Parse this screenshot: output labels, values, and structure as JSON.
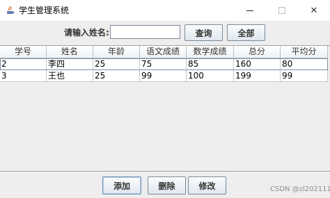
{
  "window": {
    "title": "学生管理系统",
    "minimize_glyph": "",
    "close_glyph": "✕"
  },
  "search": {
    "label": "请输入姓名:",
    "value": "",
    "placeholder": "",
    "query_label": "查询",
    "all_label": "全部"
  },
  "table": {
    "columns": [
      "学号",
      "姓名",
      "年龄",
      "语文成绩",
      "数学成绩",
      "总分",
      "平均分"
    ],
    "rows": [
      [
        "2",
        "李四",
        "25",
        "75",
        "85",
        "160",
        "80"
      ],
      [
        "3",
        "王也",
        "25",
        "99",
        "100",
        "199",
        "99"
      ]
    ]
  },
  "actions": {
    "add_label": "添加",
    "delete_label": "删除",
    "edit_label": "修改"
  },
  "watermark": "CSDN @zl202111"
}
